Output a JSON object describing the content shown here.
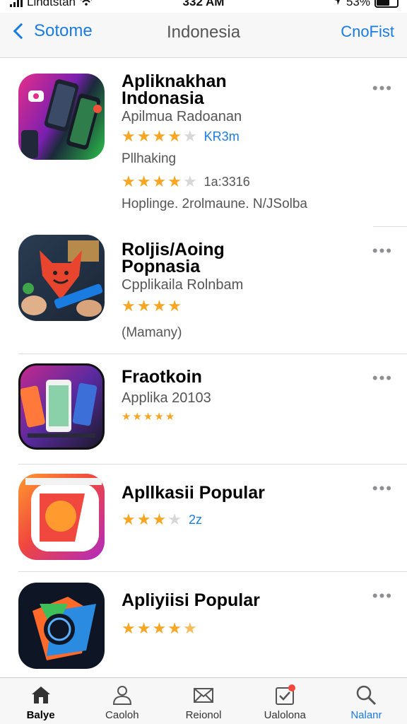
{
  "status_bar": {
    "carrier": "Lindtstan",
    "time": "332 AM",
    "battery": "53%"
  },
  "navbar": {
    "back_label": "Sotome",
    "title": "Indonesia",
    "right_label": "CnoFist"
  },
  "apps": [
    {
      "title_line1": "Apliknakhan",
      "title_line2": "Indonasia",
      "subtitle": "Apilmua Radoanan",
      "rating_count": "KR3m",
      "extra_line": "Pllhaking",
      "second_rating_count": "1a:3316",
      "footer": "Hoplinge. 2rolmaune. N/JSolba",
      "more": "•••"
    },
    {
      "title_line1": "Roljis/Aoing",
      "title_line2": "Popnasia",
      "subtitle": "Cpplikaila Rolnbam",
      "extra_line": "(Mamany)",
      "more": "•••"
    },
    {
      "title_line1": "Fraotkoin",
      "subtitle": "Applika 20103",
      "more": "•••"
    },
    {
      "title_line1": "Apllkasii Popular",
      "rating_count": "2z",
      "more": "•••"
    },
    {
      "title_line1": "Apliyiisi Popular",
      "more": "•••"
    }
  ],
  "tabs": [
    {
      "label": "Balye",
      "icon": "home-icon"
    },
    {
      "label": "Caoloh",
      "icon": "person-icon"
    },
    {
      "label": "Reionol",
      "icon": "envelope-icon"
    },
    {
      "label": "Ualolona",
      "icon": "updates-icon"
    },
    {
      "label": "Nalanr",
      "icon": "search-icon"
    }
  ],
  "colors": {
    "accent": "#1a7be0",
    "star": "#f5a623"
  }
}
